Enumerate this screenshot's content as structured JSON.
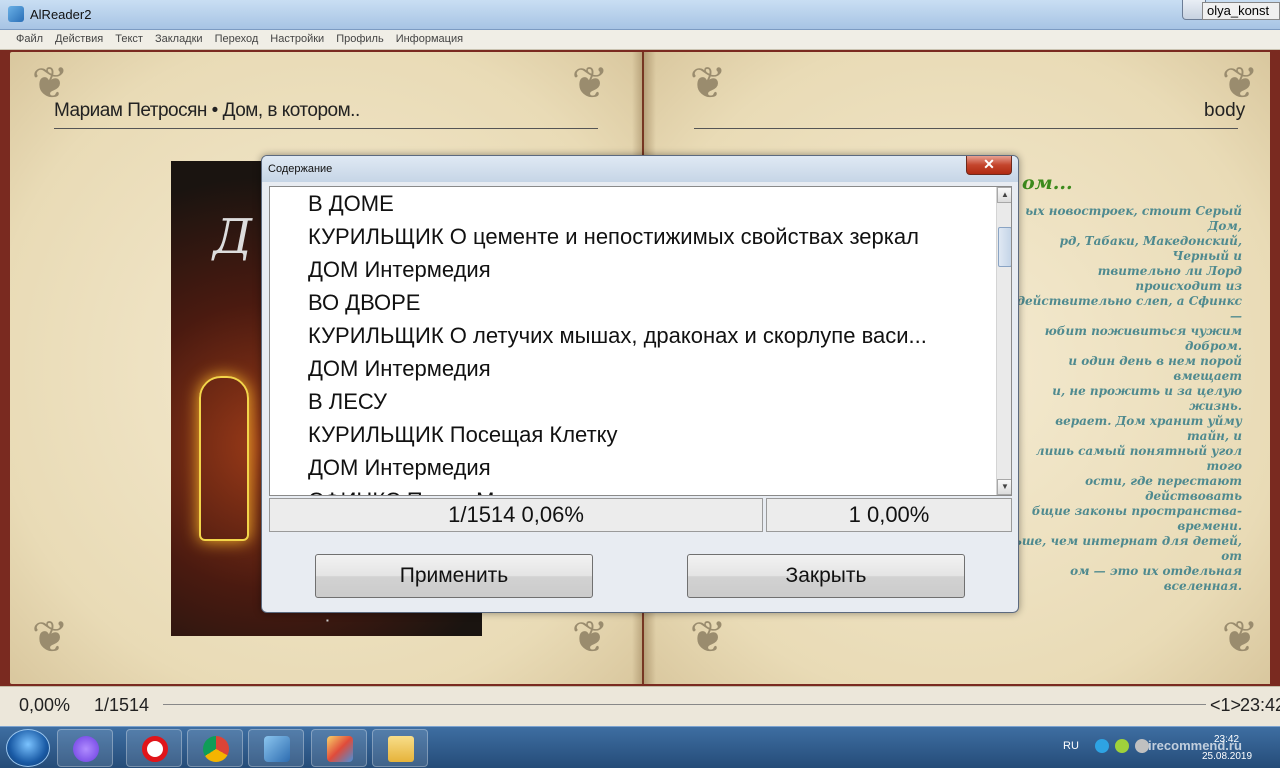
{
  "window": {
    "title": "AlReader2",
    "user": "olya_konst"
  },
  "menu": [
    "Файл",
    "Действия",
    "Текст",
    "Закладки",
    "Переход",
    "Настройки",
    "Профиль",
    "Информация"
  ],
  "book": {
    "header_left": "Мариам Петросян • Дом, в котором..",
    "header_right": "body",
    "cover_letters": "Д",
    "right_page_title": "ом...",
    "right_page_text": "ых новостроек, стоит Серый Дом,\nрд, Табаки, Македонский, Черный и\nтвительно ли Лорд происходит из\nдействительно слеп, а Сфинкс —\nюбит поживиться чужим добром.\nи один день в нем порой вмещает\nи, не прожить и за целую жизнь.\nверает. Дом хранит уйму тайн, и\nлишь самый понятный угол того\nости, где перестают действовать\nбщие законы пространства-времени.\nьше, чем интернат для детей, от\nом — это их отдельная вселенная."
  },
  "status": {
    "percent": "0,00%",
    "page": "1/1514",
    "chapter": "<1>",
    "time": "23:42"
  },
  "dialog": {
    "title": "Содержание",
    "close_glyph": "✕",
    "items": [
      "В ДОМЕ",
      "КУРИЛЬЩИК О цементе и непостижимых свойствах зеркал",
      "ДОМ Интермедия",
      "ВО ДВОРЕ",
      "КУРИЛЬЩИК О летучих мышах, драконах и скорлупе васи...",
      "ДОМ Интермедия",
      "В ЛЕСУ",
      "КУРИЛЬЩИК Посещая Клетку",
      "ДОМ Интермедия",
      "СФИНКС Песня М..."
    ],
    "position": "1/1514 0,06%",
    "chapter": "1 0,00%",
    "apply_label": "Применить",
    "close_label": "Закрыть"
  },
  "taskbar": {
    "lang": "RU",
    "time": "23:42",
    "date": "25.08.2019",
    "watermark": "irecommend.ru",
    "apps": [
      "start-icon",
      "alice-icon",
      "opera-icon",
      "chrome-icon",
      "alreader-icon",
      "paint-icon",
      "explorer-icon"
    ]
  },
  "colors": {
    "dialog_bg": "#e8ecf2",
    "page": "#efe3c4",
    "accent_title": "#3c8a1c",
    "right_text": "#4f8a8f"
  }
}
